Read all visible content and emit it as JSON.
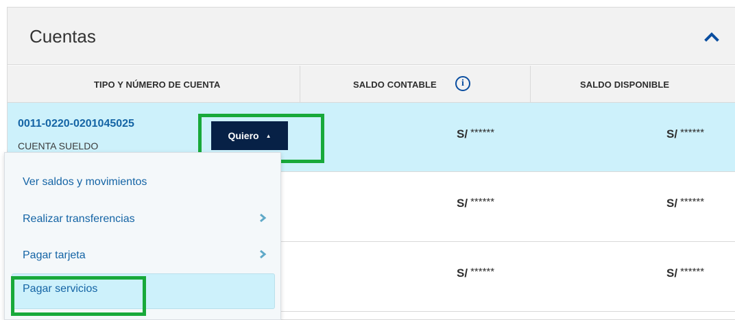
{
  "panel": {
    "title": "Cuentas"
  },
  "columns": {
    "account": "TIPO Y NÚMERO DE CUENTA",
    "ledger_balance": "SALDO CONTABLE",
    "available_balance": "SALDO DISPONIBLE",
    "info_icon_glyph": "i"
  },
  "rows": [
    {
      "number": "0011-0220-0201045025",
      "type": "CUENTA SUELDO",
      "action_label": "Quiero",
      "ledger": {
        "currency": "S/",
        "masked": "******"
      },
      "available": {
        "currency": "S/",
        "masked": "******"
      }
    },
    {
      "ledger": {
        "currency": "S/",
        "masked": "******"
      },
      "available": {
        "currency": "S/",
        "masked": "******"
      }
    },
    {
      "ledger": {
        "currency": "S/",
        "masked": "******"
      },
      "available": {
        "currency": "S/",
        "masked": "******"
      }
    }
  ],
  "menu": {
    "items": [
      {
        "label": "Ver saldos y movimientos"
      },
      {
        "label": "Realizar transferencias"
      },
      {
        "label": "Pagar tarjeta"
      },
      {
        "label": "Pagar servicios"
      }
    ]
  },
  "colors": {
    "accent": "#1464a5",
    "button": "#072146",
    "active_row": "#cdf1fb",
    "highlight": "#18a93a"
  }
}
